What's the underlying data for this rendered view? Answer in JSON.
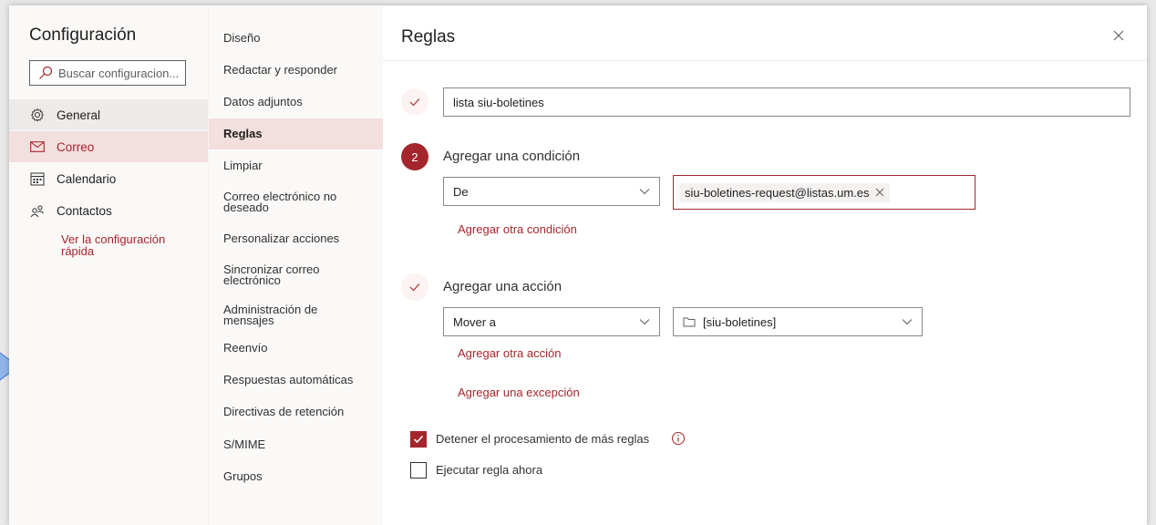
{
  "settings": {
    "title": "Configuración",
    "search_placeholder": "Buscar configuracion..."
  },
  "left_nav": {
    "items": [
      {
        "label": "General",
        "icon": "gear-icon"
      },
      {
        "label": "Correo",
        "icon": "mail-icon"
      },
      {
        "label": "Calendario",
        "icon": "calendar-icon"
      },
      {
        "label": "Contactos",
        "icon": "people-icon"
      }
    ],
    "quick_settings_link": "Ver la configuración rápida"
  },
  "mid_nav": {
    "items": [
      {
        "label": "Diseño"
      },
      {
        "label": "Redactar y responder"
      },
      {
        "label": "Datos adjuntos"
      },
      {
        "label": "Reglas"
      },
      {
        "label": "Limpiar"
      },
      {
        "label": "Correo electrónico no deseado"
      },
      {
        "label": "Personalizar acciones"
      },
      {
        "label": "Sincronizar correo electrónico"
      },
      {
        "label": "Administración de mensajes"
      },
      {
        "label": "Reenvío"
      },
      {
        "label": "Respuestas automáticas"
      },
      {
        "label": "Directivas de retención"
      },
      {
        "label": "S/MIME"
      },
      {
        "label": "Grupos"
      }
    ],
    "selected": "Reglas"
  },
  "rule": {
    "title": "Reglas",
    "name_value": "lista siu-boletines",
    "condition": {
      "step_number": "2",
      "label": "Agregar una condición",
      "field": "De",
      "recipient": "siu-boletines-request@listas.um.es",
      "add_link": "Agregar otra condición"
    },
    "action": {
      "label": "Agregar una acción",
      "field": "Mover a",
      "folder": "[siu-boletines]",
      "add_link": "Agregar otra acción"
    },
    "exception_link": "Agregar una excepción",
    "stop_processing": {
      "label": "Detener el procesamiento de más reglas",
      "checked": true
    },
    "run_now": {
      "label": "Ejecutar regla ahora",
      "checked": false
    }
  },
  "colors": {
    "accent": "#a4262c",
    "selected_bg": "#f3dfde",
    "nav_bg": "#faf9f8"
  }
}
